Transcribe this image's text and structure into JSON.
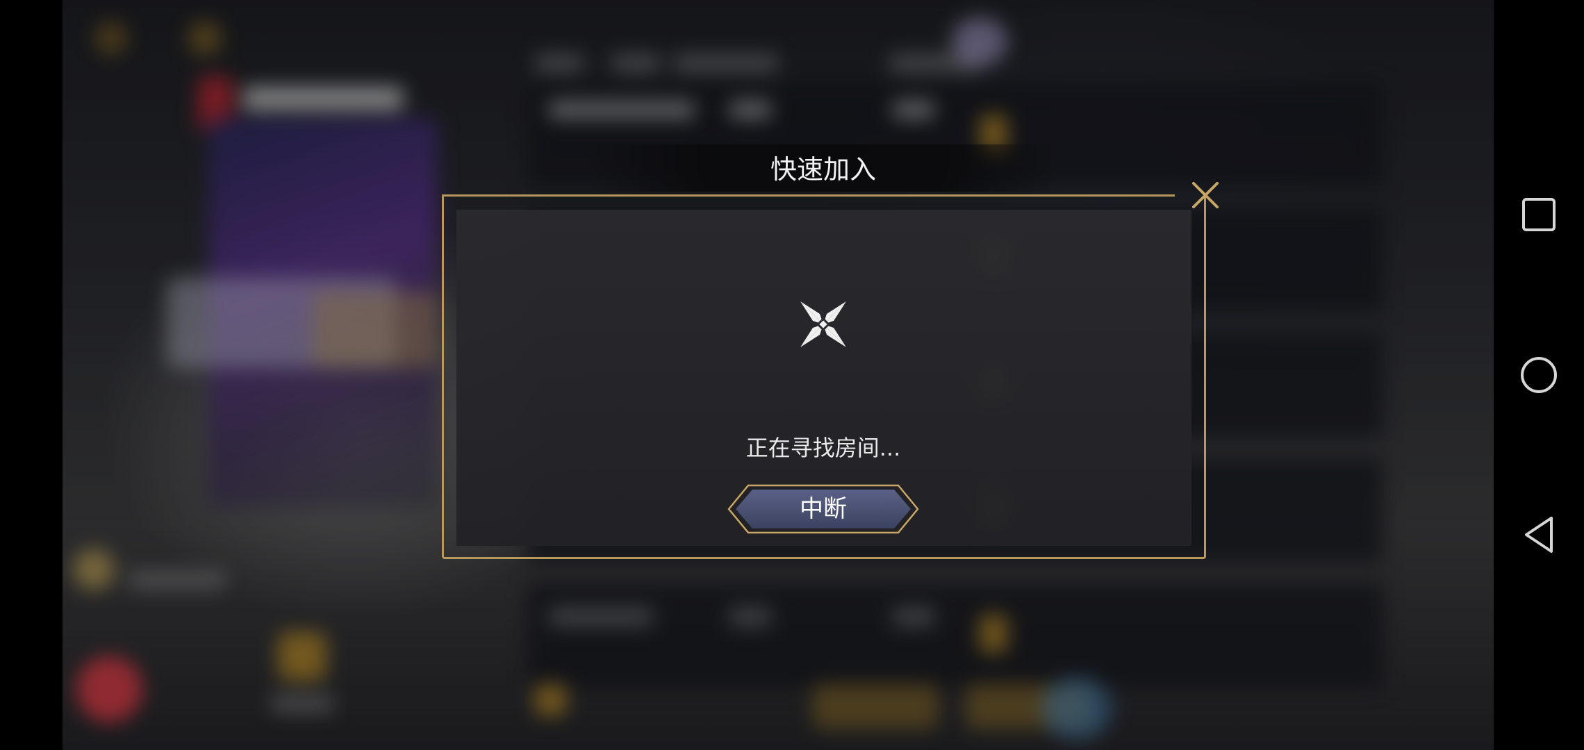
{
  "dialog": {
    "title": "快速加入",
    "status_text": "正在寻找房间...",
    "abort_label": "中断"
  },
  "icons": {
    "close": "close-icon",
    "loader": "shuriken-loading-icon",
    "nav_recents": "square-icon",
    "nav_home": "circle-icon",
    "nav_back": "triangle-back-icon"
  },
  "colors": {
    "frame_gold": "#b89a5c",
    "button_blue": "#4b5270",
    "panel": "#2a2a2e"
  }
}
